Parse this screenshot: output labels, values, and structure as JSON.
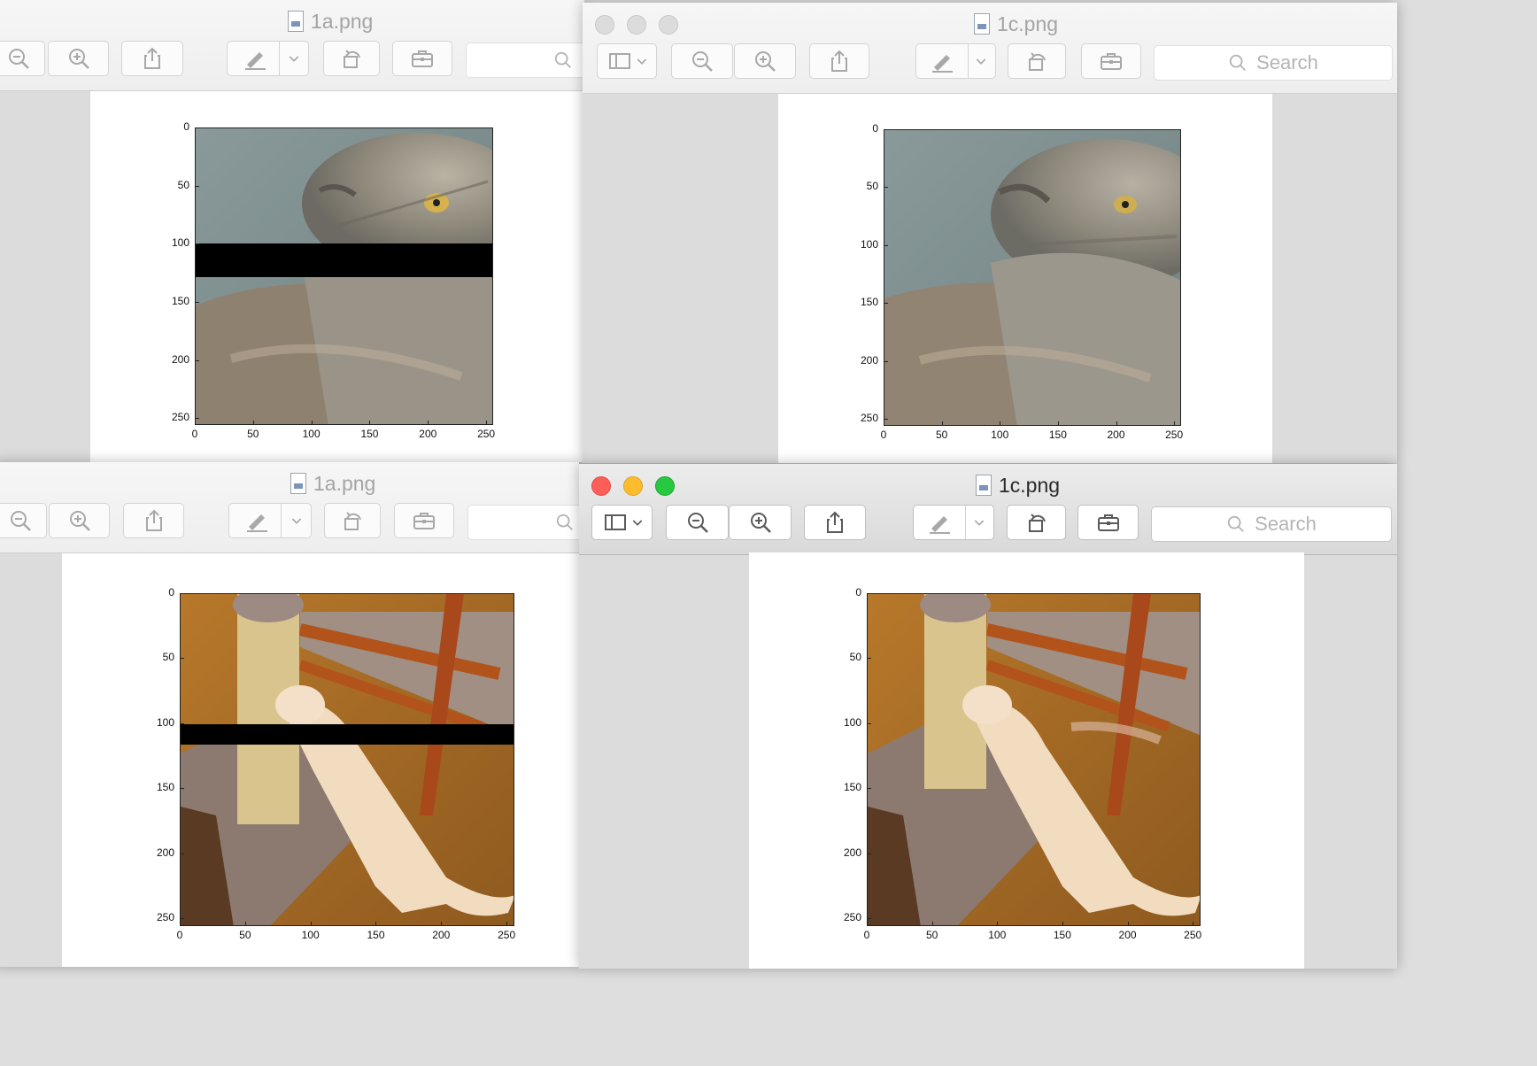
{
  "windows": [
    {
      "id": "top-left",
      "filename": "1a.png",
      "active": false,
      "search_placeholder": "",
      "plot": {
        "x_ticks": [
          "0",
          "50",
          "100",
          "150",
          "200",
          "250"
        ],
        "y_ticks": [
          "0",
          "50",
          "100",
          "150",
          "200",
          "250"
        ],
        "image_subject": "pallas-cat",
        "masked_band_rows": [
          100,
          129
        ]
      }
    },
    {
      "id": "top-right",
      "filename": "1c.png",
      "active": false,
      "search_placeholder": "Search",
      "plot": {
        "x_ticks": [
          "0",
          "50",
          "100",
          "150",
          "200",
          "250"
        ],
        "y_ticks": [
          "0",
          "50",
          "100",
          "150",
          "200",
          "250"
        ],
        "image_subject": "pallas-cat-inpainted"
      }
    },
    {
      "id": "bottom-left",
      "filename": "1a.png",
      "active": false,
      "search_placeholder": "",
      "plot": {
        "x_ticks": [
          "0",
          "50",
          "100",
          "150",
          "200",
          "250"
        ],
        "y_ticks": [
          "0",
          "50",
          "100",
          "150",
          "200",
          "250"
        ],
        "image_subject": "cat-on-scratching-post",
        "masked_band_rows": [
          100,
          116
        ]
      }
    },
    {
      "id": "bottom-right",
      "filename": "1c.png",
      "active": true,
      "search_placeholder": "Search",
      "plot": {
        "x_ticks": [
          "0",
          "50",
          "100",
          "150",
          "200",
          "250"
        ],
        "y_ticks": [
          "0",
          "50",
          "100",
          "150",
          "200",
          "250"
        ],
        "image_subject": "cat-on-scratching-post-inpainted"
      }
    }
  ],
  "toolbar_icons": [
    "sidebar-icon",
    "zoom-out-icon",
    "zoom-in-icon",
    "share-icon",
    "markup-icon",
    "rotate-icon",
    "toolbox-icon",
    "search-icon"
  ],
  "colors": {
    "close": "#fc5f57",
    "minimize": "#fdbc2e",
    "zoom": "#28c840",
    "mask": "#000000"
  }
}
